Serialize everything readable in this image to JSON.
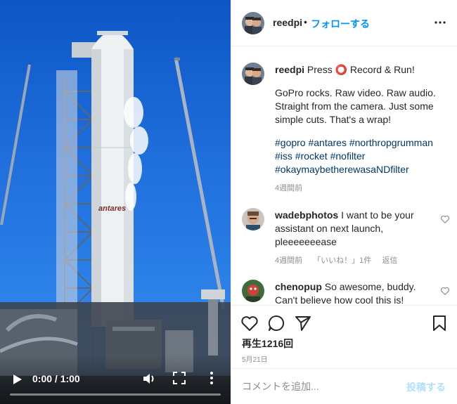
{
  "post": {
    "username": "reedpi",
    "separator": "•",
    "follow_label": "フォローする",
    "caption": {
      "title": "Press ⭕ Record & Run!",
      "body": "GoPro rocks. Raw video. Raw audio. Straight from the camera. Just some simple cuts. That's a wrap!",
      "hashtags": "#gopro #antares #northropgrumman #iss #rocket #nofilter #okaymaybetherewasaNDfilter",
      "time": "4週間前"
    },
    "comments": [
      {
        "username": "wadebphotos",
        "text": "I want to be your assistant on next launch, pleeeeeeease",
        "time": "4週間前",
        "likes": "「いいね！」1件",
        "reply_label": "返信"
      },
      {
        "username": "chenopup",
        "text": "So awesome, buddy. Can't believe how cool this is!"
      }
    ],
    "views": "再生1216回",
    "date": "5月21日",
    "comment_placeholder": "コメントを追加...",
    "post_label": "投稿する"
  },
  "video": {
    "time": "0:00 / 1:00",
    "progress_percent": 0,
    "rocket_label": "antares"
  },
  "colors": {
    "accent": "#0095f6",
    "hashtag": "#00376b",
    "muted": "#8e8e8e",
    "post_disabled": "#b2dffc"
  },
  "icons": [
    "play-icon",
    "volume-icon",
    "fullscreen-icon",
    "more-vertical-icon",
    "more-horizontal-icon",
    "heart-icon",
    "comment-icon",
    "share-icon",
    "bookmark-icon"
  ]
}
